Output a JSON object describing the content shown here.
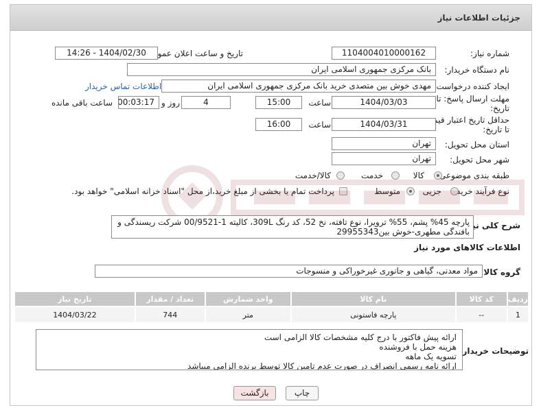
{
  "header": {
    "title": "جزئیات اطلاعات نیاز"
  },
  "fields": {
    "need_number_label": "شماره نیاز:",
    "need_number": "1104004010000162",
    "announce_label": "تاریخ و ساعت اعلان عمومی:",
    "announce_value": "1404/02/30 - 14:26",
    "buyer_org_label": "نام دستگاه خریدار:",
    "buyer_org": "بانک مرکزی جمهوری اسلامی ایران",
    "requester_label": "ایجاد کننده درخواست:",
    "requester": "مهدی خوش بین متصدی خرید بانک مرکزی جمهوری اسلامی ایران",
    "contact_link": "اطلاعات تماس خریدار",
    "deadline_label_1": "مهلت ارسال پاسخ: تا",
    "deadline_label_2": "تاریخ:",
    "deadline_date": "1404/03/03",
    "time_label": "ساعت",
    "deadline_time": "15:00",
    "days_value": "4",
    "days_label": "روز و",
    "remaining_time": "00:03:17",
    "remaining_label": "ساعت باقی مانده",
    "min_valid_label_1": "حداقل تاریخ اعتبار قیمت:",
    "min_valid_label_2": "تا تاریخ:",
    "valid_date": "1404/03/31",
    "valid_time": "16:00",
    "province_label": "استان محل تحویل:",
    "province": "تهران",
    "city_label": "شهر محل تحویل:",
    "city": "تهران",
    "category_label": "طبقه بندی موضوعی:",
    "category_options": [
      "کالا",
      "خدمت",
      "کالا/خدمت"
    ],
    "process_label": "نوع فرآیند خرید :",
    "process_options": [
      "جزیی",
      "متوسط"
    ],
    "payment_note": "پرداخت تمام یا بخشی از مبلغ خرید،از محل \"اسناد خزانه اسلامی\" خواهد بود."
  },
  "description": {
    "label": "شرح کلی نیاز:",
    "text": "پارچه 45% پشم، 55% ترویرا، نوع تافته، نخ 52، کد رنگ 309L، کالیته 1-00/9521 شرکت ریسندگی و بافندگی مطهری-خوش بین29955343"
  },
  "goods": {
    "section_title": "اطلاعات کالاهای مورد نیاز",
    "group_label": "گروه کالا:",
    "group_value": "مواد معدنی، گیاهی و جانوری غیرخوراکی و منسوجات",
    "columns": [
      "ردیف",
      "کد کالا",
      "نام کالا",
      "واحد شمارش",
      "تعداد / مقدار",
      "تاریخ نیاز"
    ],
    "rows": [
      [
        "1",
        "--",
        "پارچه فاستونی",
        "متر",
        "744",
        "1404/03/22"
      ]
    ]
  },
  "buyer_notes": {
    "label": "توضیحات خریدار:",
    "lines": [
      "ارائه پیش فاکتور با درج کلیه مشخصات کالا الزامی است",
      "هزینه حمل با فروشنده",
      "تسویه یک ماهه",
      "ارائه نامه رسمی انصراف در صورت عدم تامین کالا توسط برنده الزامی میباشد"
    ]
  },
  "buttons": {
    "print": "چاپ",
    "back": "بازگشت"
  },
  "colors": {
    "link": "#2a62b8",
    "back_button_bg": "#f8e3e3",
    "table_header": "#c8c8c8"
  }
}
